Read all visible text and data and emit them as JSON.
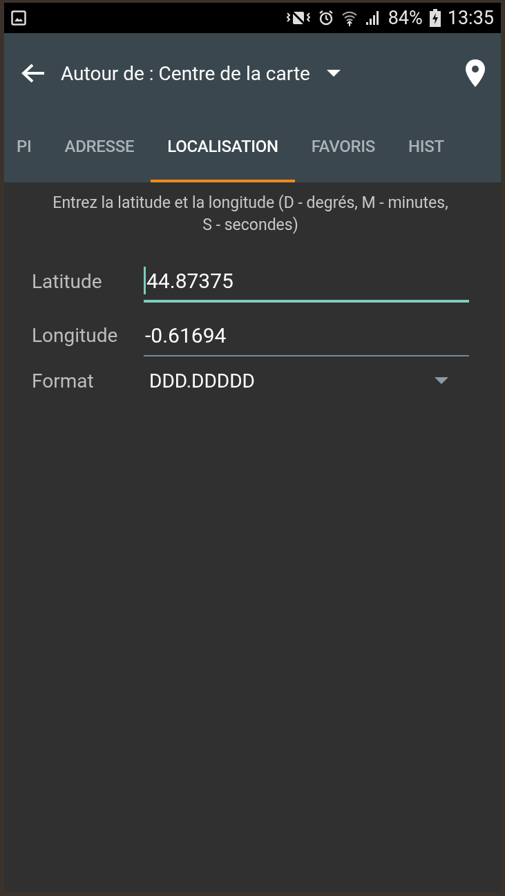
{
  "status_bar": {
    "battery": "84%",
    "time": "13:35"
  },
  "app_bar": {
    "title": "Autour de : Centre de la carte"
  },
  "tabs": [
    {
      "label": "PI",
      "selected": false
    },
    {
      "label": "ADRESSE",
      "selected": false
    },
    {
      "label": "LOCALISATION",
      "selected": true
    },
    {
      "label": "FAVORIS",
      "selected": false
    },
    {
      "label": "HIST",
      "selected": false
    }
  ],
  "instructions": "Entrez la latitude et la longitude (D - degrés, M - minutes, S - secondes)",
  "fields": [
    {
      "kind": "text",
      "label": "Latitude",
      "value": "44.87375",
      "focused": true
    },
    {
      "kind": "text",
      "label": "Longitude",
      "value": "-0.61694",
      "focused": false
    },
    {
      "kind": "dropdown",
      "label": "Format",
      "value": "DDD.DDDDD"
    }
  ]
}
